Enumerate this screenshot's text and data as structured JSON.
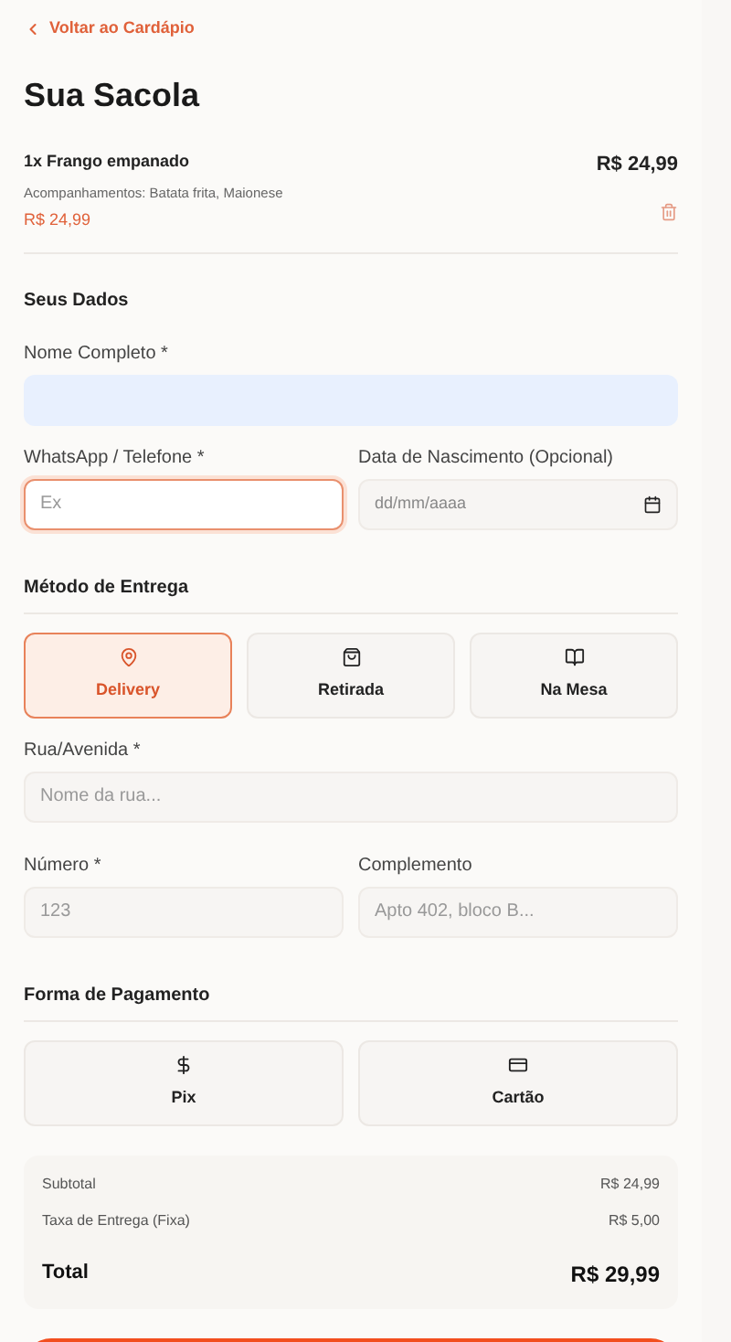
{
  "back_link": "Voltar ao Cardápio",
  "title": "Sua Sacola",
  "cart_items": [
    {
      "name": "1x Frango empanado",
      "price": "R$ 24,99",
      "details": "Acompanhamentos: Batata frita, Maionese",
      "unit_price": "R$ 24,99"
    }
  ],
  "personal_data": {
    "heading": "Seus Dados",
    "name_field": {
      "label": "Nome Completo *",
      "autofilled": true
    },
    "phone_field": {
      "label": "WhatsApp / Telefone *",
      "placeholder": "Ex",
      "focused": true
    },
    "birth_field": {
      "label": "Data de Nascimento (Opcional)",
      "placeholder": "dd/mm/aaaa"
    }
  },
  "delivery": {
    "heading": "Método de Entrega",
    "methods": [
      {
        "label": "Delivery",
        "kind": "pin",
        "selected": true
      },
      {
        "label": "Retirada",
        "kind": "bag",
        "selected": false
      },
      {
        "label": "Na Mesa",
        "kind": "book",
        "selected": false
      }
    ],
    "street_field": {
      "label": "Rua/Avenida *",
      "placeholder": "Nome da rua..."
    },
    "number_field": {
      "label": "Número *",
      "placeholder": "123"
    },
    "complement_field": {
      "label": "Complemento",
      "placeholder": "Apto 402, bloco B..."
    }
  },
  "payment": {
    "heading": "Forma de Pagamento",
    "methods": [
      {
        "label": "Pix",
        "kind": "dollar",
        "selected": false
      },
      {
        "label": "Cartão",
        "kind": "card",
        "selected": false
      }
    ]
  },
  "summary": {
    "rows": [
      {
        "label": "Subtotal",
        "value": "R$ 24,99"
      },
      {
        "label": "Taxa de Entrega (Fixa)",
        "value": "R$ 5,00"
      }
    ],
    "total_label": "Total",
    "total_value": "R$ 29,99"
  }
}
